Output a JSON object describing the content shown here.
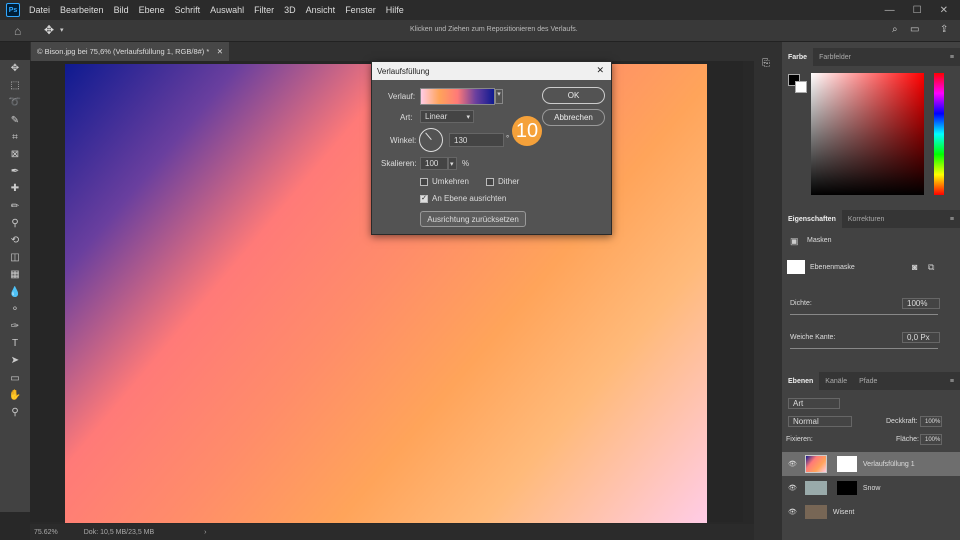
{
  "menu": [
    "Datei",
    "Bearbeiten",
    "Bild",
    "Ebene",
    "Schrift",
    "Auswahl",
    "Filter",
    "3D",
    "Ansicht",
    "Fenster",
    "Hilfe"
  ],
  "app_logo": "Ps",
  "options_hint": "Klicken und Ziehen zum Repositionieren des Verlaufs.",
  "doc_tab": "© Bison.jpg bei 75,6% (Verlaufsfüllung 1, RGB/8#) *",
  "status": {
    "zoom": "75.62%",
    "doc": "Dok: 10,5 MB/23,5 MB"
  },
  "dialog": {
    "title": "Verlaufsfüllung",
    "verlauf_label": "Verlauf:",
    "art_label": "Art:",
    "art_value": "Linear",
    "winkel_label": "Winkel:",
    "winkel_value": "130",
    "degree": "°",
    "skalieren_label": "Skalieren:",
    "skalieren_value": "100",
    "percent": "%",
    "umkehren": "Umkehren",
    "dither": "Dither",
    "an_ebene": "An Ebene ausrichten",
    "reset_button": "Ausrichtung zurücksetzen",
    "ok": "OK",
    "cancel": "Abbrechen",
    "step": "10"
  },
  "color_panel": {
    "tabs": [
      "Farbe",
      "Farbfelder"
    ]
  },
  "props_panel": {
    "tabs": [
      "Eigenschaften",
      "Korrekturen"
    ],
    "masks": "Masken",
    "ebenenmaske": "Ebenenmaske",
    "dichte_label": "Dichte:",
    "dichte_value": "100%",
    "kante_label": "Weiche Kante:",
    "kante_value": "0,0 Px"
  },
  "layers_panel": {
    "tabs": [
      "Ebenen",
      "Kanäle",
      "Pfade"
    ],
    "kind": "Art",
    "mode": "Normal",
    "deckkraft": "Deckkraft:",
    "deckkraft_val": "100%",
    "fixieren": "Fixieren:",
    "flaeche": "Fläche:",
    "flaeche_val": "100%",
    "layers": [
      "Verlaufsfüllung 1",
      "Snow",
      "Wisent"
    ]
  }
}
